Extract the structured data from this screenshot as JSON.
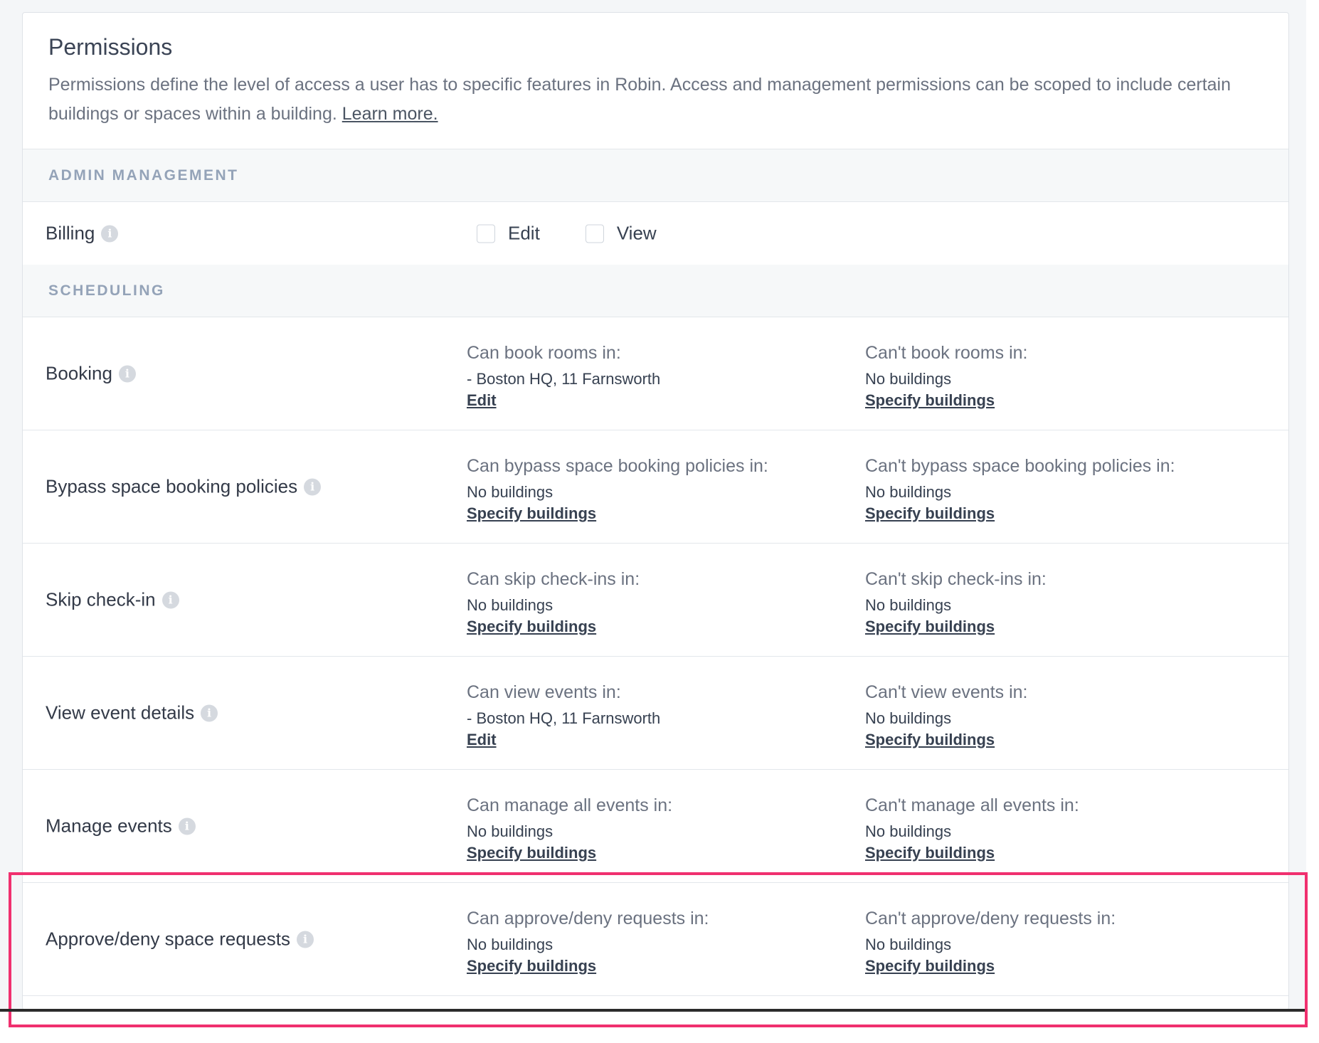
{
  "header": {
    "title": "Permissions",
    "description": "Permissions define the level of access a user has to specific features in Robin. Access and management permissions can be scoped to include certain buildings or spaces within a building.",
    "learn_more": "Learn more."
  },
  "sections": {
    "admin": "ADMIN MANAGEMENT",
    "scheduling": "SCHEDULING"
  },
  "billing": {
    "label": "Billing",
    "edit_label": "Edit",
    "view_label": "View",
    "edit_checked": false,
    "view_checked": false
  },
  "rows": [
    {
      "label": "Booking",
      "can_head": "Can book rooms in:",
      "can_value": "- Boston HQ, 11 Farnsworth",
      "can_link": "Edit",
      "cant_head": "Can't book rooms in:",
      "cant_value": "No buildings",
      "cant_link": "Specify buildings"
    },
    {
      "label": "Bypass space booking policies",
      "can_head": "Can bypass space booking policies in:",
      "can_value": "No buildings",
      "can_link": "Specify buildings",
      "cant_head": "Can't bypass space booking policies in:",
      "cant_value": "No buildings",
      "cant_link": "Specify buildings"
    },
    {
      "label": "Skip check-in",
      "can_head": "Can skip check-ins in:",
      "can_value": "No buildings",
      "can_link": "Specify buildings",
      "cant_head": "Can't skip check-ins in:",
      "cant_value": "No buildings",
      "cant_link": "Specify buildings"
    },
    {
      "label": "View event details",
      "can_head": "Can view events in:",
      "can_value": "- Boston HQ, 11 Farnsworth",
      "can_link": "Edit",
      "cant_head": "Can't view events in:",
      "cant_value": "No buildings",
      "cant_link": "Specify buildings"
    },
    {
      "label": "Manage events",
      "can_head": "Can manage all events in:",
      "can_value": "No buildings",
      "can_link": "Specify buildings",
      "cant_head": "Can't manage all events in:",
      "cant_value": "No buildings",
      "cant_link": "Specify buildings"
    },
    {
      "label": "Approve/deny space requests",
      "can_head": "Can approve/deny requests in:",
      "can_value": "No buildings",
      "can_link": "Specify buildings",
      "cant_head": "Can't approve/deny requests in:",
      "cant_value": "No buildings",
      "cant_link": "Specify buildings"
    }
  ],
  "icons": {
    "info": "info-icon",
    "info_glyph": "i"
  },
  "colors": {
    "highlight": "#f0306f",
    "section_text": "#94a3b8"
  }
}
